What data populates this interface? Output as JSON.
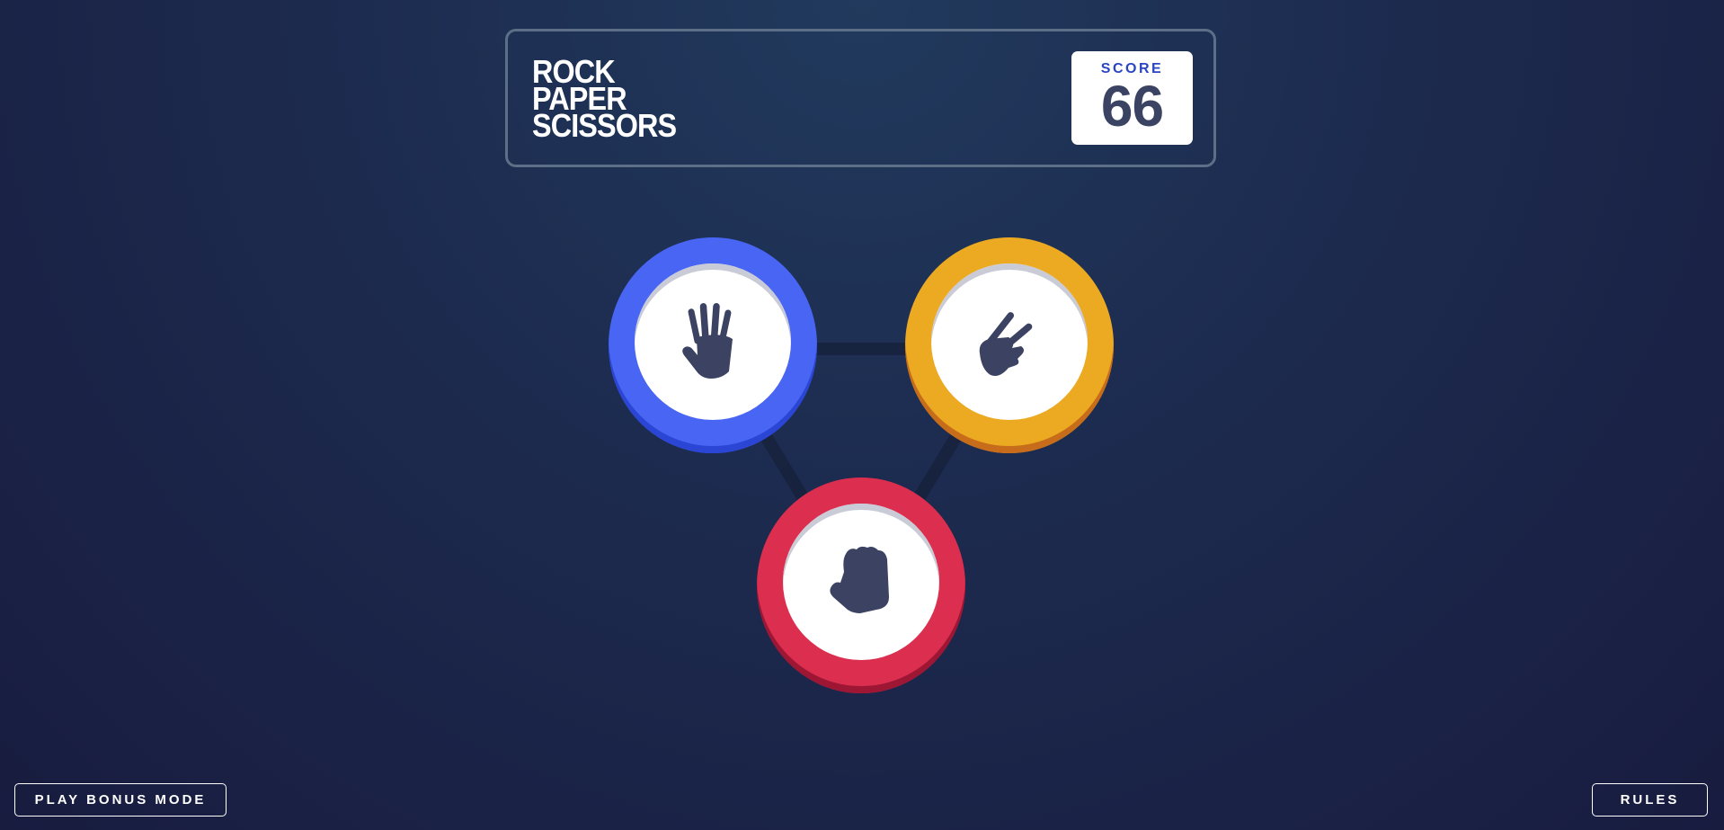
{
  "header": {
    "title_lines": [
      "ROCK",
      "PAPER",
      "SCISSORS"
    ],
    "score_label": "SCORE",
    "score_value": "66"
  },
  "choices": [
    {
      "id": "paper",
      "icon": "paper-hand-icon",
      "ring_color": "#4865f4"
    },
    {
      "id": "scissors",
      "icon": "scissors-hand-icon",
      "ring_color": "#eca922"
    },
    {
      "id": "rock",
      "icon": "rock-fist-icon",
      "ring_color": "#dc2e4e"
    }
  ],
  "footer": {
    "bonus_label": "PLAY BONUS MODE",
    "rules_label": "RULES"
  }
}
